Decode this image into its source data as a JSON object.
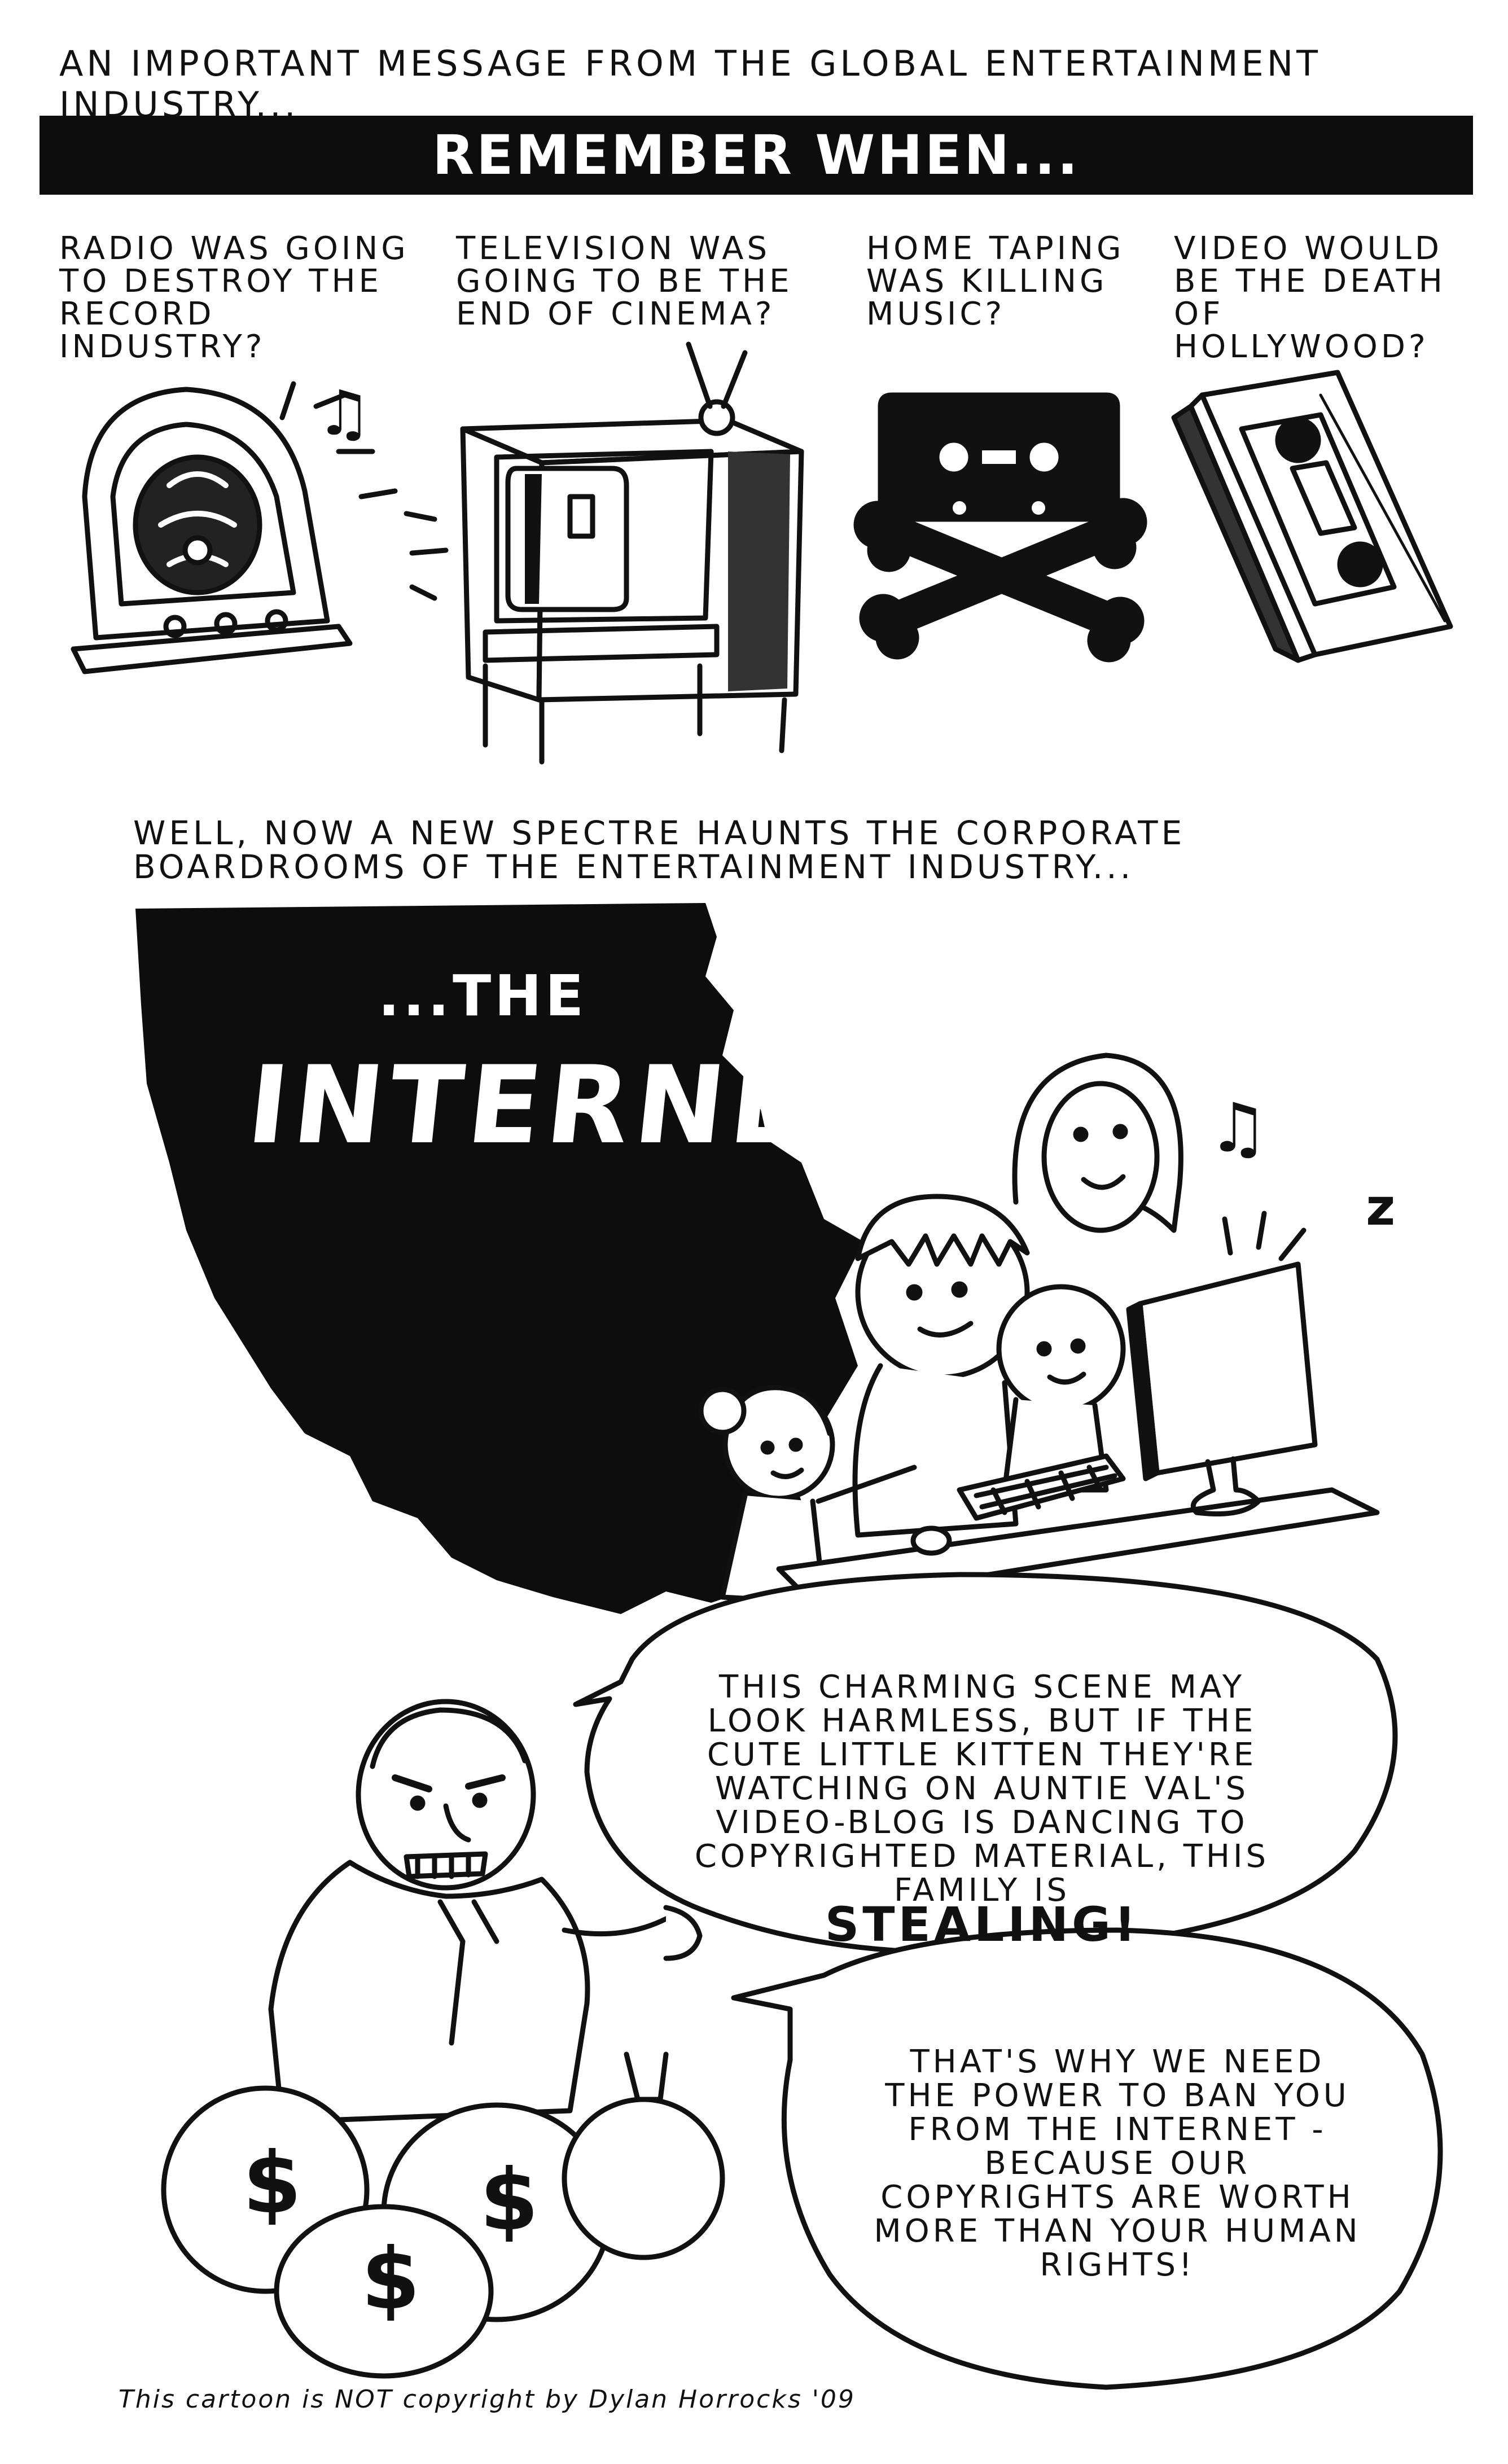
{
  "header": {
    "intro": "AN IMPORTANT MESSAGE FROM THE GLOBAL ENTERTAINMENT INDUSTRY..."
  },
  "banner": {
    "title": "REMEMBER WHEN..."
  },
  "panels": [
    {
      "caption": "RADIO WAS GOING TO DESTROY THE RECORD INDUSTRY?",
      "icon": "radio-icon"
    },
    {
      "caption": "TELEVISION WAS GOING TO BE THE END OF CINEMA?",
      "icon": "television-icon"
    },
    {
      "caption": "HOME TAPING WAS KILLING MUSIC?",
      "icon": "cassette-crossbones-icon"
    },
    {
      "caption": "VIDEO WOULD BE THE DEATH OF HOLLYWOOD?",
      "icon": "videotape-icon"
    }
  ],
  "spectre": {
    "text": "WELL, NOW A NEW SPECTRE HAUNTS THE CORPORATE BOARDROOMS OF THE ENTERTAINMENT INDUSTRY...",
    "the": "...THE",
    "title": "INTERNET!"
  },
  "speech": {
    "bubble1": "THIS CHARMING SCENE MAY LOOK HARMLESS, BUT IF THE CUTE LITTLE KITTEN THEY'RE WATCHING ON AUNTIE VAL'S VIDEO-BLOG IS DANCING TO COPYRIGHTED MATERIAL, THIS FAMILY IS",
    "bubble1_emphasis": "STEALING!",
    "bubble2": "THAT'S WHY WE NEED THE POWER TO BAN YOU FROM THE INTERNET - BECAUSE OUR COPYRIGHTS ARE WORTH MORE THAN YOUR HUMAN RIGHTS!"
  },
  "money_symbol": "$",
  "music_note": "♫",
  "credit": "This cartoon is NOT copyright by Dylan Horrocks '09",
  "colors": {
    "ink": "#111111",
    "paper": "#ffffff"
  }
}
